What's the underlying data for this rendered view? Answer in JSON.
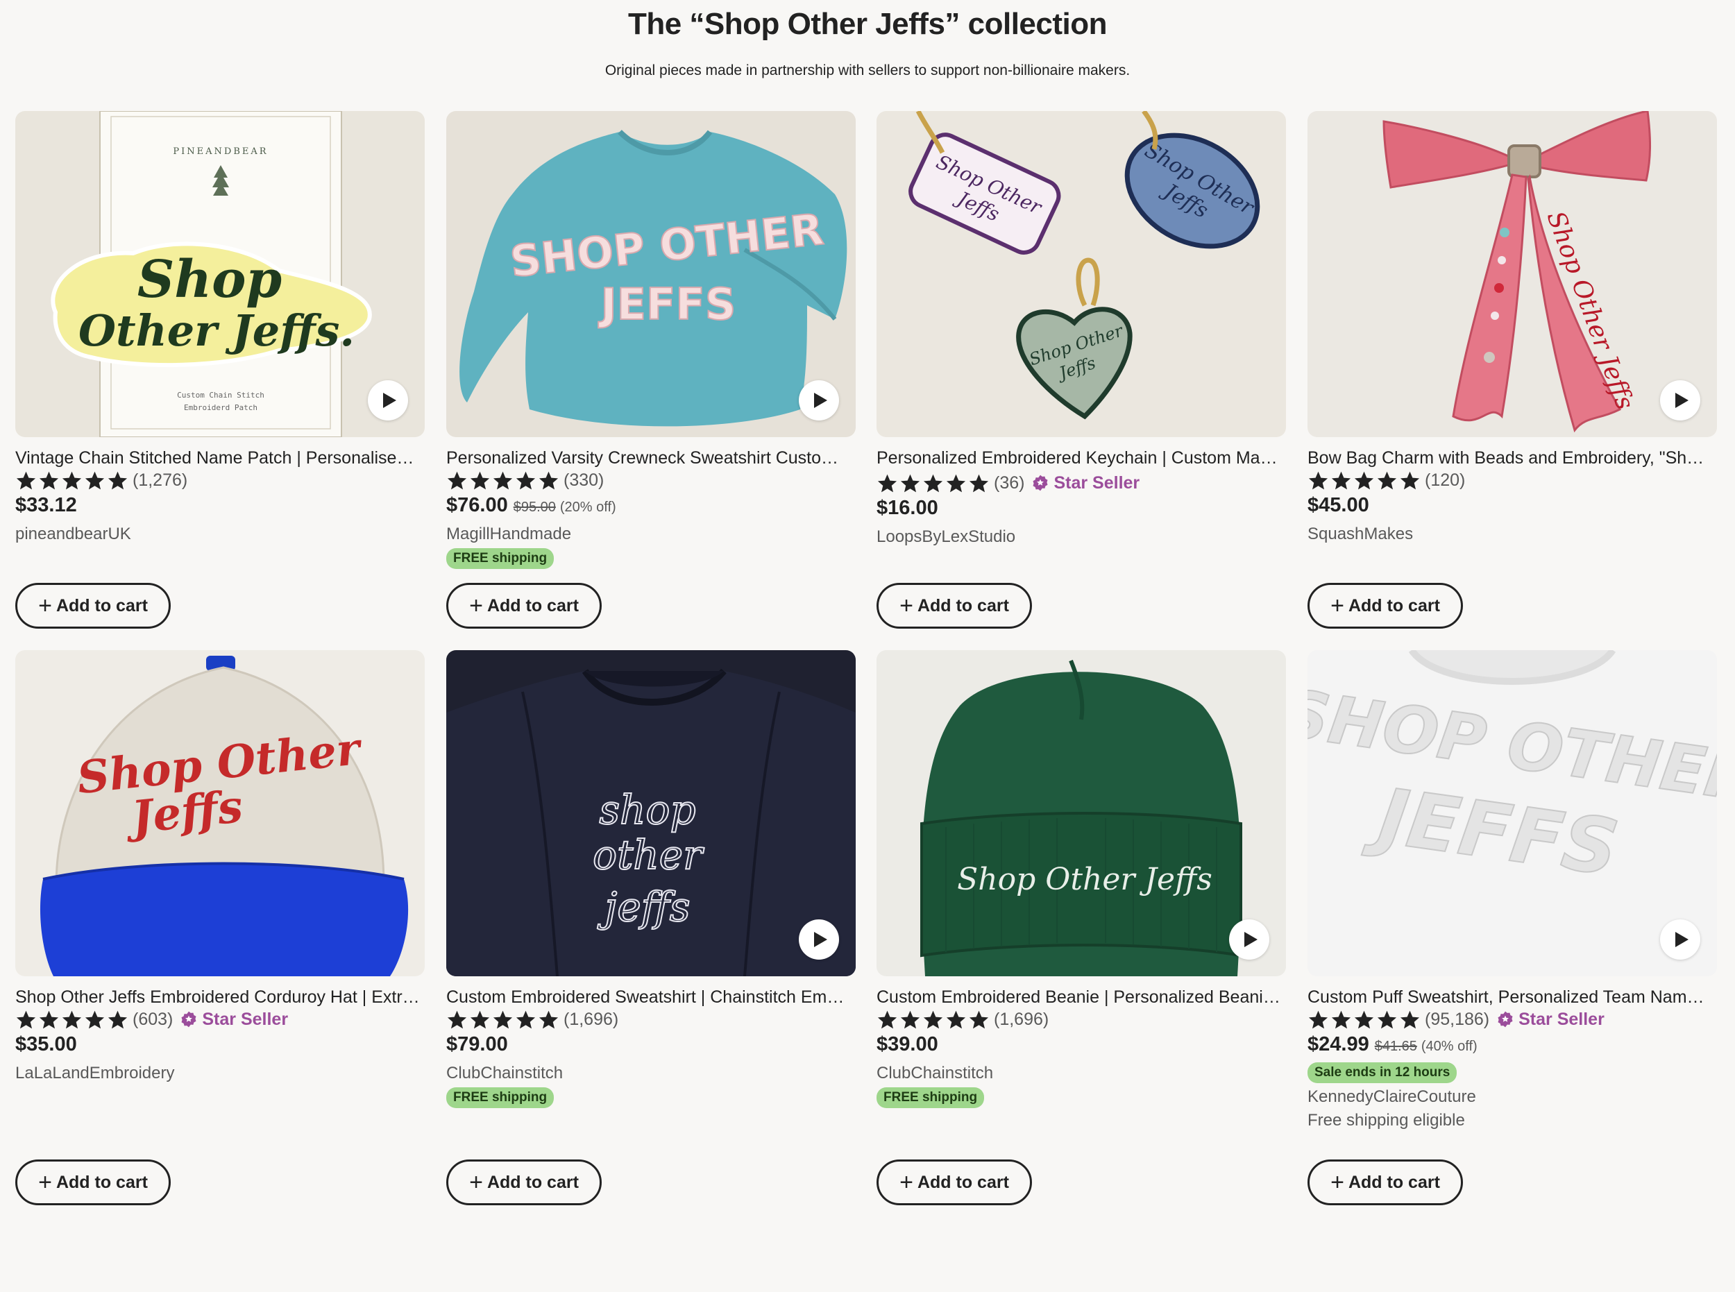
{
  "header": {
    "title": "The “Shop Other Jeffs” collection",
    "subtitle": "Original pieces made in partnership with sellers to support non-billionaire makers."
  },
  "colors": {
    "star_seller": "#9b4d9b",
    "badge_green": "#9ed68b",
    "text": "#222222",
    "muted": "#595959"
  },
  "cart_label": "Add to cart",
  "products": [
    {
      "title": "Vintage Chain Stitched Name Patch | Personalised Embroidered Patch",
      "rating_count": "(1,276)",
      "stars": 5,
      "star_seller": "",
      "price": "$33.12",
      "original_price": "",
      "discount": "",
      "shop": "pineandbearUK",
      "badge": "",
      "extra": "",
      "has_video": true,
      "image": {
        "brand": "PINEANDBEAR",
        "line1": "Shop",
        "line2": "Other Jeffs.",
        "caption1": "Custom Chain Stitch",
        "caption2": "Embroiderd Patch"
      }
    },
    {
      "title": "Personalized Varsity Crewneck Sweatshirt Custom Embroidered",
      "rating_count": "(330)",
      "stars": 5,
      "star_seller": "",
      "price": "$76.00",
      "original_price": "$95.00",
      "discount": "(20% off)",
      "shop": "MagillHandmade",
      "badge": "FREE shipping",
      "extra": "",
      "has_video": true,
      "image": {
        "line1": "SHOP OTHER",
        "line2": "JEFFS"
      }
    },
    {
      "title": "Personalized Embroidered Keychain | Custom Made Patch Keychain",
      "rating_count": "(36)",
      "stars": 5,
      "star_seller": "Star Seller",
      "price": "$16.00",
      "original_price": "",
      "discount": "",
      "shop": "LoopsByLexStudio",
      "badge": "",
      "extra": "",
      "has_video": false,
      "image": {
        "tag1a": "Shop Other",
        "tag1b": "Jeffs",
        "tag2a": "Shop Other",
        "tag2b": "Jeffs",
        "tag3a": "Shop Other",
        "tag3b": "Jeffs"
      }
    },
    {
      "title": "Bow Bag Charm with Beads and Embroidery, \"Shop Other Jeffs\"",
      "rating_count": "(120)",
      "stars": 5,
      "star_seller": "",
      "price": "$45.00",
      "original_price": "",
      "discount": "",
      "shop": "SquashMakes",
      "badge": "",
      "extra": "",
      "has_video": true,
      "image": {
        "text": "Shop Other Jeffs"
      }
    },
    {
      "title": "Shop Other Jeffs Embroidered Corduroy Hat | Extra Large Embroidery",
      "rating_count": "(603)",
      "stars": 5,
      "star_seller": "Star Seller",
      "price": "$35.00",
      "original_price": "",
      "discount": "",
      "shop": "LaLaLandEmbroidery",
      "badge": "",
      "extra": "",
      "has_video": false,
      "image": {
        "line1": "Shop Other",
        "line2": "Jeffs"
      }
    },
    {
      "title": "Custom Embroidered Sweatshirt | Chainstitch Embroidery Crewneck",
      "rating_count": "(1,696)",
      "stars": 5,
      "star_seller": "",
      "price": "$79.00",
      "original_price": "",
      "discount": "",
      "shop": "ClubChainstitch",
      "badge": "FREE shipping",
      "extra": "",
      "has_video": true,
      "image": {
        "line1": "shop",
        "line2": "other",
        "line3": "jeffs"
      }
    },
    {
      "title": "Custom Embroidered Beanie | Personalized Beanie Hat",
      "rating_count": "(1,696)",
      "stars": 5,
      "star_seller": "",
      "price": "$39.00",
      "original_price": "",
      "discount": "",
      "shop": "ClubChainstitch",
      "badge": "FREE shipping",
      "extra": "",
      "has_video": true,
      "image": {
        "text": "Shop Other Jeffs"
      }
    },
    {
      "title": "Custom Puff Sweatshirt, Personalized Team Name Crewneck",
      "rating_count": "(95,186)",
      "stars": 5,
      "star_seller": "Star Seller",
      "price": "$24.99",
      "original_price": "$41.65",
      "discount": "(40% off)",
      "shop": "KennedyClaireCouture",
      "badge": "Sale ends in 12 hours",
      "extra": "Free shipping eligible",
      "has_video": true,
      "image": {
        "line1": "SHOP OTHER",
        "line2": "JEFFS"
      }
    }
  ]
}
